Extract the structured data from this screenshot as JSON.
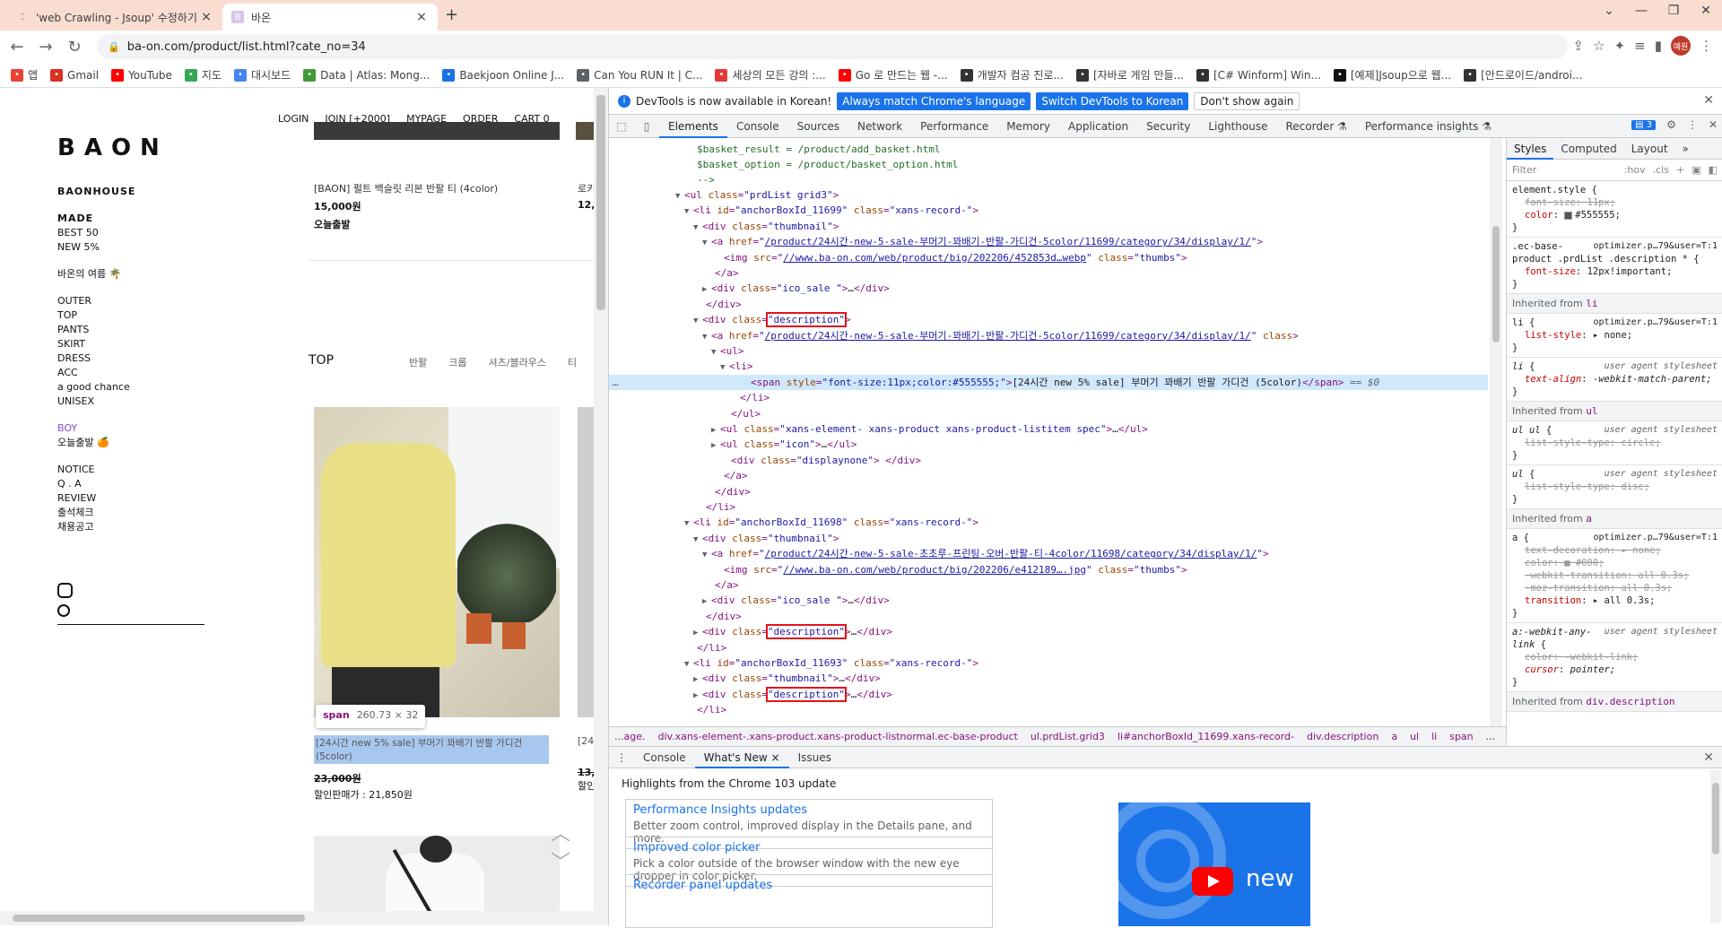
{
  "browser": {
    "tabs": [
      {
        "title": "'web Crawling - Jsoup' 수정하기",
        "icon": "tistory-icon"
      },
      {
        "title": "바온",
        "icon": "baon-favicon"
      }
    ],
    "url": "ba-on.com/product/list.html?cate_no=34",
    "profile_initial": "예원",
    "bookmarks": [
      {
        "label": "앱",
        "icon": "apps-icon"
      },
      {
        "label": "Gmail",
        "icon": "gmail-icon"
      },
      {
        "label": "YouTube",
        "icon": "youtube-icon"
      },
      {
        "label": "지도",
        "icon": "maps-icon"
      },
      {
        "label": "대시보드",
        "icon": "dashboard-icon"
      },
      {
        "label": "Data | Atlas: Mong...",
        "icon": "mongodb-icon"
      },
      {
        "label": "Baekjoon Online J...",
        "icon": "code-icon"
      },
      {
        "label": "Can You RUN It | C...",
        "icon": "link-icon"
      },
      {
        "label": "세상의 모든 강의 :...",
        "icon": "play-icon"
      },
      {
        "label": "Go 로 만드는 웹 -...",
        "icon": "youtube-icon"
      },
      {
        "label": "개발자 컴공 진로...",
        "icon": "tistory-icon"
      },
      {
        "label": "[자바로 게임 만들...",
        "icon": "tistory-icon"
      },
      {
        "label": "[C# Winform] Win...",
        "icon": "tistory-icon"
      },
      {
        "label": "[예제]Jsoup으로 웹...",
        "icon": "velog-icon"
      },
      {
        "label": "[안드로이드/androi...",
        "icon": "tistory-icon"
      }
    ]
  },
  "site": {
    "logo": "BAON",
    "top_nav": [
      "LOGIN",
      "JOIN [+2000]",
      "MYPAGE",
      "ORDER",
      "CART 0"
    ],
    "side": {
      "brand": "BAONHOUSE",
      "made": "MADE",
      "best": "BEST 50",
      "new": "NEW 5%",
      "summer": "바온의 여름 🌴",
      "cats": [
        "OUTER",
        "TOP",
        "PANTS",
        "SKIRT",
        "DRESS",
        "ACC",
        "a good chance",
        "UNISEX"
      ],
      "boy": "BOY",
      "today": "오늘출발 🍊",
      "info": [
        "NOTICE",
        "Q . A",
        "REVIEW",
        "출석체크",
        "채용공고"
      ]
    },
    "product1": {
      "name": "[BAON] 펄트 백슬릿 리본 반팔 티 (4color)",
      "price": "15,000원",
      "ship": "오늘출발"
    },
    "product2_cut": {
      "name": "로키",
      "price": "12,"
    },
    "category_title": "TOP",
    "category_tabs": [
      "반팔",
      "크롭",
      "셔츠/블라우스",
      "티"
    ],
    "tooltip": {
      "tag": "span",
      "size": "260.73 × 32"
    },
    "product3": {
      "name": "[24시간 new 5% sale] 부머기 꽈배기 반팔 가디건 (5color)",
      "old_price": "23,000원",
      "sale_price": "할인판매가 : 21,850원"
    },
    "product4_cut": {
      "name": "[24",
      "price": "13,",
      "sale": "할인"
    }
  },
  "devtools": {
    "info_text": "DevTools is now available in Korean!",
    "btn_match": "Always match Chrome's language",
    "btn_switch": "Switch DevTools to Korean",
    "btn_dont": "Don't show again",
    "tabs": [
      "Elements",
      "Console",
      "Sources",
      "Network",
      "Performance",
      "Memory",
      "Application",
      "Security",
      "Lighthouse",
      "Recorder ⚗",
      "Performance insights ⚗"
    ],
    "issues_count": "3",
    "dom_lines": [
      {
        "indent": 0,
        "tri": "",
        "html": "$basket_result = /product/add_basket.html",
        "kind": "text"
      },
      {
        "indent": 0,
        "tri": "",
        "html": "$basket_option = /product/basket_option.html",
        "kind": "text"
      },
      {
        "indent": 0,
        "tri": "",
        "html": "-->",
        "kind": "text"
      }
    ],
    "breadcrumbs": [
      "...age.",
      "div.xans-element-.xans-product.xans-product-listnormal.ec-base-product",
      "ul.prdList.grid3",
      "li#anchorBoxId_11699.xans-record-",
      "div.description",
      "a",
      "ul",
      "li",
      "span",
      "..."
    ],
    "styles_tabs": [
      "Styles",
      "Computed",
      "Layout",
      "»"
    ],
    "filter_placeholder": "Filter",
    "filter_tools": [
      ":hov",
      ".cls",
      "+"
    ],
    "drawer_tabs": [
      "Console",
      "What's New",
      "Issues"
    ],
    "drawer_heading": "Highlights from the Chrome 103 update",
    "cards": [
      {
        "title": "Performance Insights updates",
        "desc": "Better zoom control, improved display in the Details pane, and more."
      },
      {
        "title": "Improved color picker",
        "desc": "Pick a color outside of the browser window with the new eye dropper in color picker."
      },
      {
        "title": "Recorder panel updates",
        "desc": ""
      }
    ],
    "video_label": "new"
  }
}
